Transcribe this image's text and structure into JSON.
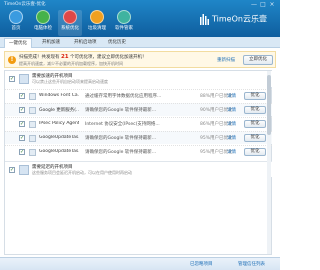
{
  "window": {
    "title": "TimeOn云乐壹-优化",
    "controls": [
      "—",
      "□",
      "×"
    ]
  },
  "nav": [
    {
      "label": "首页",
      "color": "#3a9be0"
    },
    {
      "label": "电脑体检",
      "color": "#46b24a"
    },
    {
      "label": "系统优化",
      "color": "#e04848"
    },
    {
      "label": "垃圾清理",
      "color": "#f0a020"
    },
    {
      "label": "软件管家",
      "color": "#3fb3a0"
    }
  ],
  "logo": {
    "text": "TimeOn云乐壹"
  },
  "tabs": [
    "一键优化",
    "开机加速",
    "开机启动项",
    "优化历史"
  ],
  "info": {
    "prefix": "扫描完成！共发现有",
    "count": "21",
    "suffix": "个可优化项，建议立即优化加速开机！",
    "sub": "提高开机速度，减少不必要的开机加载程序，加快开机时间",
    "link": "重新扫描",
    "button": "立即优化"
  },
  "groups": [
    {
      "title": "需要加速的开机项目",
      "subtitle": "可以禁止这些开机自启动项来提高启动速度",
      "rows": [
        {
          "name": "Windows Font Ca...",
          "desc": "通过缓存常用字体数据优化应用程序...",
          "status": "88%用户已优化",
          "link": "详情",
          "button": "优化"
        },
        {
          "name": "Google 更新服务(...",
          "desc": "请确保您的Google 软件保持最新...",
          "status": "90%用户已优化",
          "link": "详情",
          "button": "优化"
        },
        {
          "name": "IPsec Policy Agent",
          "desc": "Internet 协议安全(IPsec)支持网络...",
          "status": "86%用户已优化",
          "link": "详情",
          "button": "优化"
        },
        {
          "name": "GoogleUpdateTas...",
          "desc": "请确保您的Google 软件保持最新...",
          "status": "95%用户已优化",
          "link": "详情",
          "button": "优化"
        },
        {
          "name": "GoogleUpdateTas...",
          "desc": "请确保您的Google 软件保持最新...",
          "status": "95%用户已优化",
          "link": "详情",
          "button": "优化"
        }
      ]
    },
    {
      "title": "需要延迟的开机项目",
      "subtitle": "这些服务项目会延迟开机启动，可以在用户使用时再启动",
      "rows": []
    }
  ],
  "footer": {
    "left": "",
    "ignore": "已忽略项目",
    "exception": "管理信任列表"
  }
}
